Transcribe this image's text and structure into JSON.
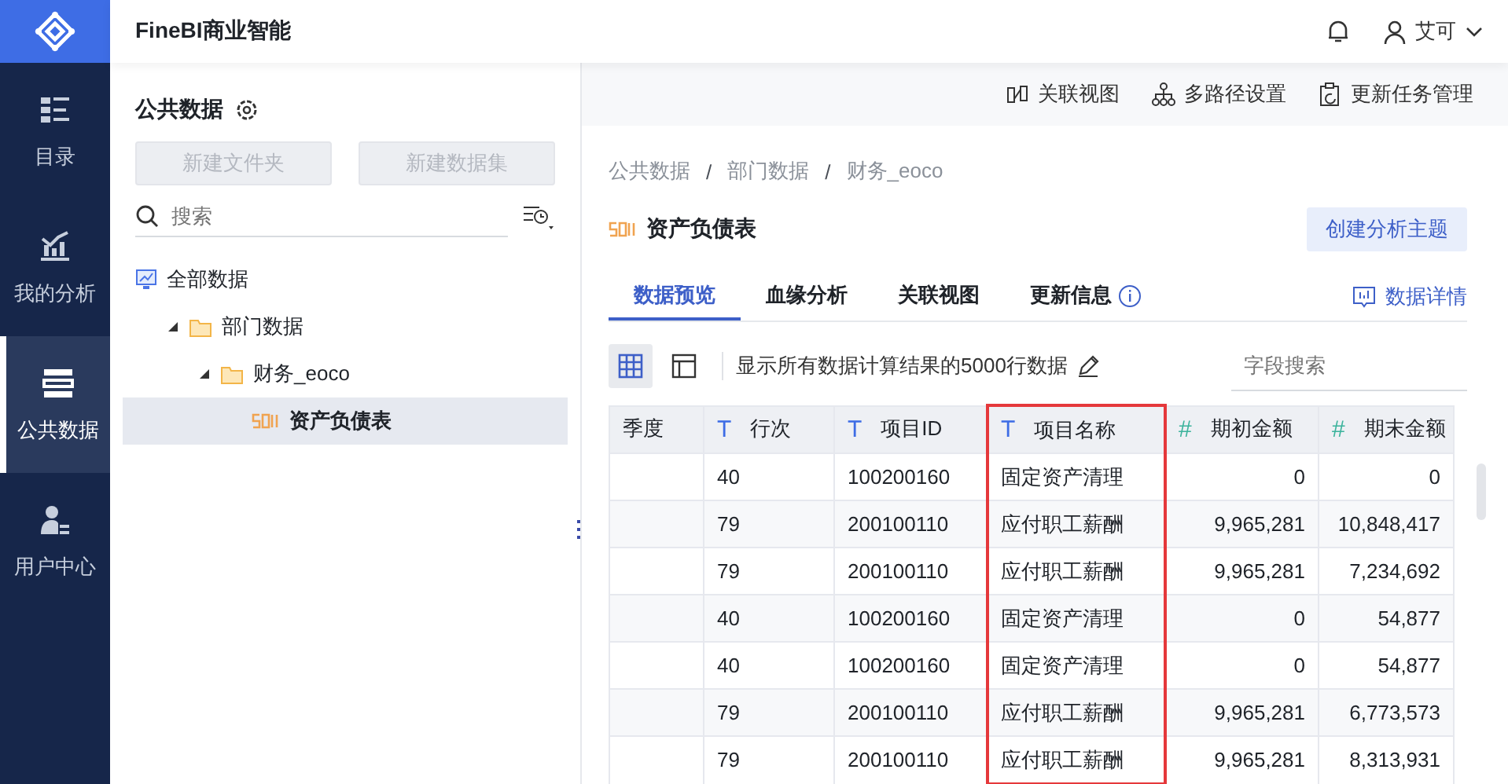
{
  "app": {
    "title": "FineBI商业智能"
  },
  "nav": [
    {
      "label": "目录",
      "kind": "catalog",
      "selected": false
    },
    {
      "label": "我的分析",
      "kind": "analysis",
      "selected": false
    },
    {
      "label": "公共数据",
      "kind": "public",
      "selected": true
    },
    {
      "label": "用户中心",
      "kind": "user",
      "selected": false
    }
  ],
  "user": {
    "name": "艾可"
  },
  "panel": {
    "title": "公共数据",
    "buttons": [
      {
        "label": "新建文件夹",
        "disabled": true
      },
      {
        "label": "新建数据集",
        "disabled": true
      }
    ],
    "search": {
      "placeholder": "搜索"
    },
    "tree": [
      {
        "label": "全部数据",
        "kind": "root",
        "selected": false,
        "children": [
          {
            "label": "部门数据",
            "kind": "folder",
            "expanded": true,
            "selected": false,
            "children": [
              {
                "label": "财务_eoco",
                "kind": "folder",
                "expanded": true,
                "selected": false,
                "children": [
                  {
                    "label": "资产负债表",
                    "kind": "table",
                    "selected": true
                  }
                ]
              }
            ]
          }
        ]
      }
    ]
  },
  "toolbar": [
    {
      "label": "关联视图",
      "kind": "relation"
    },
    {
      "label": "多路径设置",
      "kind": "paths"
    },
    {
      "label": "更新任务管理",
      "kind": "tasks"
    }
  ],
  "breadcrumb": [
    {
      "label": "公共数据",
      "kind": "link"
    },
    {
      "label": "/",
      "kind": "separator"
    },
    {
      "label": "部门数据",
      "kind": "link"
    },
    {
      "label": "/",
      "kind": "separator"
    },
    {
      "label": "财务_eoco",
      "kind": "link"
    }
  ],
  "dataset": {
    "title": "资产负债表",
    "action": "创建分析主题"
  },
  "tabs": [
    {
      "label": "数据预览",
      "selected": true,
      "info": false
    },
    {
      "label": "血缘分析",
      "selected": false,
      "info": false
    },
    {
      "label": "关联视图",
      "selected": false,
      "info": false
    },
    {
      "label": "更新信息",
      "selected": false,
      "info": true
    }
  ],
  "details_link": "数据详情",
  "views": [
    {
      "kind": "grid",
      "selected": true
    },
    {
      "kind": "layout",
      "selected": false
    }
  ],
  "row_note": "显示所有数据计算结果的5000行数据",
  "field_search": {
    "placeholder": "字段搜索"
  },
  "table": {
    "columns": [
      {
        "label": "季度",
        "highlighted": false
      },
      {
        "label": "行次",
        "kind": "text",
        "type_icon": "T",
        "highlighted": false
      },
      {
        "label": "项目ID",
        "kind": "text",
        "type_icon": "T",
        "highlighted": false
      },
      {
        "label": "项目名称",
        "kind": "text",
        "type_icon": "T",
        "highlighted": true
      },
      {
        "label": "期初金额",
        "kind": "number",
        "type_icon": "#",
        "highlighted": false
      },
      {
        "label": "期末金额",
        "kind": "number",
        "type_icon": "#",
        "highlighted": false
      }
    ],
    "rows": [
      [
        "",
        "40",
        "100200160",
        "固定资产清理",
        "0",
        "0"
      ],
      [
        "",
        "79",
        "200100110",
        "应付职工薪酬",
        "9,965,281",
        "10,848,417"
      ],
      [
        "",
        "79",
        "200100110",
        "应付职工薪酬",
        "9,965,281",
        "7,234,692"
      ],
      [
        "",
        "40",
        "100200160",
        "固定资产清理",
        "0",
        "54,877"
      ],
      [
        "",
        "40",
        "100200160",
        "固定资产清理",
        "0",
        "54,877"
      ],
      [
        "",
        "79",
        "200100110",
        "应付职工薪酬",
        "9,965,281",
        "6,773,573"
      ],
      [
        "",
        "79",
        "200100110",
        "应付职工薪酬",
        "9,965,281",
        "8,313,931"
      ]
    ]
  }
}
